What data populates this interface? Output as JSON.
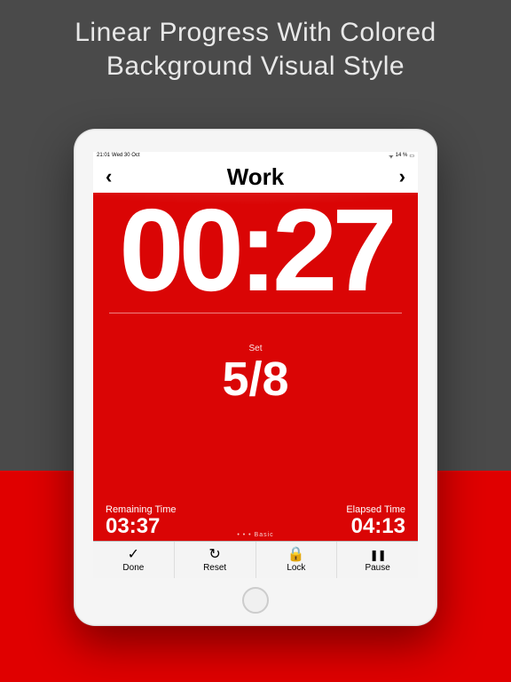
{
  "promo": {
    "headline_line1": "Linear Progress  With Colored",
    "headline_line2": "Background Visual Style"
  },
  "status_bar": {
    "time": "21:01",
    "date": "Wed 30 Oct",
    "battery": "14 %",
    "wifi_icon": "wifi"
  },
  "header": {
    "prev_glyph": "‹",
    "title": "Work",
    "next_glyph": "›"
  },
  "timer": {
    "main_time": "00:27",
    "set_label": "Set",
    "set_value": "5/8",
    "remaining_label": "Remaining Time",
    "remaining_value": "03:37",
    "elapsed_label": "Elapsed Time",
    "elapsed_value": "04:13",
    "page_indicator": "• • • Basic"
  },
  "toolbar": {
    "done": {
      "label": "Done",
      "glyph": "✓"
    },
    "reset": {
      "label": "Reset",
      "glyph": "↻"
    },
    "lock": {
      "label": "Lock",
      "glyph": "🔒"
    },
    "pause": {
      "label": "Pause",
      "glyph": "❚❚"
    }
  },
  "colors": {
    "accent_red": "#da0505",
    "promo_bg_grey": "#4a4a4a",
    "promo_bg_red": "#e00000"
  }
}
